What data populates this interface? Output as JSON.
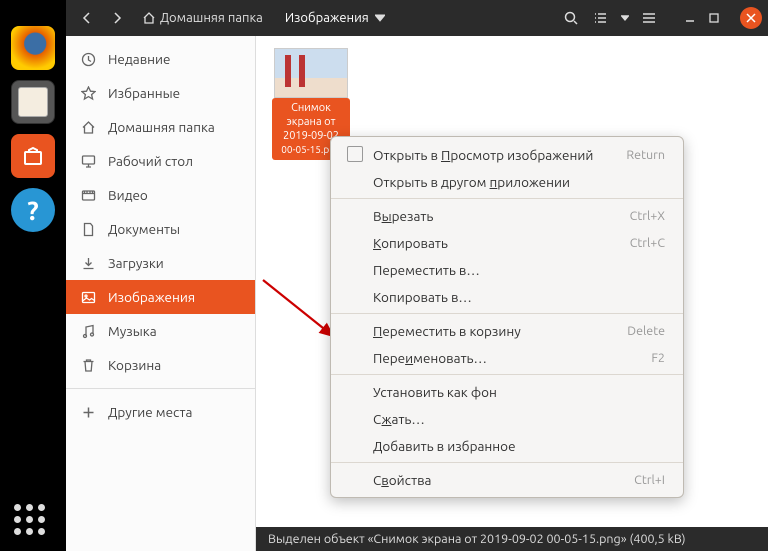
{
  "dock": {
    "items": [
      "firefox",
      "files",
      "software",
      "help"
    ]
  },
  "titlebar": {
    "home": "Домашняя папка",
    "location": "Изображения"
  },
  "sidebar": {
    "items": [
      {
        "icon": "clock",
        "label": "Недавние"
      },
      {
        "icon": "star",
        "label": "Избранные"
      },
      {
        "icon": "home",
        "label": "Домашняя папка"
      },
      {
        "icon": "desktop",
        "label": "Рабочий стол"
      },
      {
        "icon": "video",
        "label": "Видео"
      },
      {
        "icon": "doc",
        "label": "Документы"
      },
      {
        "icon": "download",
        "label": "Загрузки"
      },
      {
        "icon": "image",
        "label": "Изображения",
        "active": true
      },
      {
        "icon": "music",
        "label": "Музыка"
      },
      {
        "icon": "trash",
        "label": "Корзина"
      }
    ],
    "other": "Другие места"
  },
  "file": {
    "label_line1": "Снимок",
    "label_line2": "экрана от",
    "label_line3": "2019-09-02",
    "label_line4": "00-05-15.png"
  },
  "context_menu": {
    "items": [
      {
        "label_pre": "Открыть в ",
        "label_ul": "П",
        "label_post": "росмотр изображений",
        "shortcut": "Return",
        "icon": true
      },
      {
        "label_pre": "Открыть в другом ",
        "label_ul": "п",
        "label_post": "риложении"
      },
      {
        "sep": true
      },
      {
        "label_pre": "В",
        "label_ul": "ы",
        "label_post": "резать",
        "shortcut": "Ctrl+X"
      },
      {
        "label_pre": "",
        "label_ul": "К",
        "label_post": "опировать",
        "shortcut": "Ctrl+C"
      },
      {
        "label_pre": "Переместить в…"
      },
      {
        "label_pre": "Копировать в…"
      },
      {
        "sep": true
      },
      {
        "label_pre": "",
        "label_ul": "П",
        "label_post": "ереместить в корзину",
        "shortcut": "Delete"
      },
      {
        "label_pre": "Пере",
        "label_ul": "и",
        "label_post": "меновать…",
        "shortcut": "F2"
      },
      {
        "sep": true
      },
      {
        "label_pre": "Установить как фон"
      },
      {
        "label_pre": "С",
        "label_ul": "ж",
        "label_post": "ать…"
      },
      {
        "label_pre": "Добавить в избранное"
      },
      {
        "sep": true
      },
      {
        "label_pre": "С",
        "label_ul": "в",
        "label_post": "ойства",
        "shortcut": "Ctrl+I"
      }
    ]
  },
  "statusbar": {
    "text": "Выделен объект «Снимок экрана от 2019-09-02 00-05-15.png»  (400,5 kB)"
  }
}
